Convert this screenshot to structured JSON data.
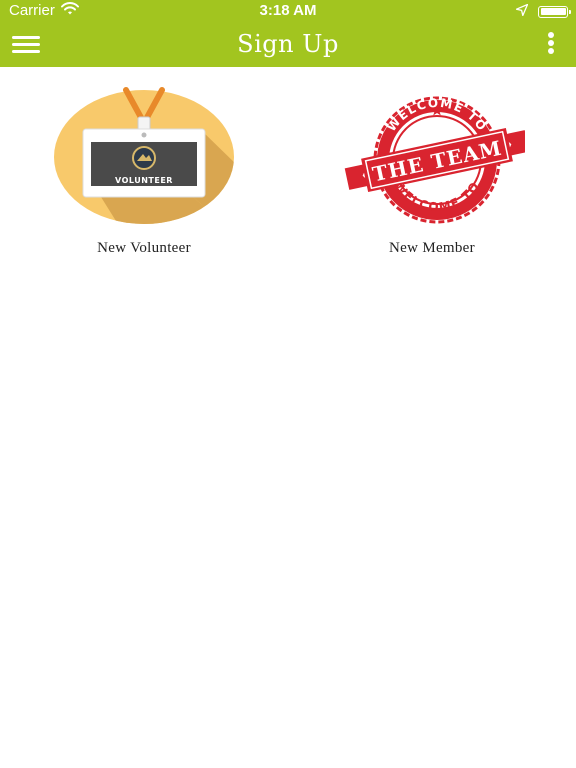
{
  "status_bar": {
    "carrier": "Carrier",
    "time": "3:18 AM",
    "wifi_icon": "wifi-icon",
    "location_icon": "location-arrow-icon",
    "battery_icon": "battery-icon"
  },
  "nav_bar": {
    "title": "Sign Up",
    "menu_icon": "hamburger-menu-icon",
    "more_icon": "vertical-more-icon",
    "background_color": "#a2c51f"
  },
  "tiles": [
    {
      "label": "New Volunteer",
      "image_text": "VOLUNTEER",
      "icon": "volunteer-badge-icon"
    },
    {
      "label": "New Member",
      "image_text_top": "WELCOME TO",
      "image_text_center": "THE TEAM",
      "image_text_bottom": "WELCOME TO",
      "icon": "welcome-stamp-icon"
    }
  ]
}
